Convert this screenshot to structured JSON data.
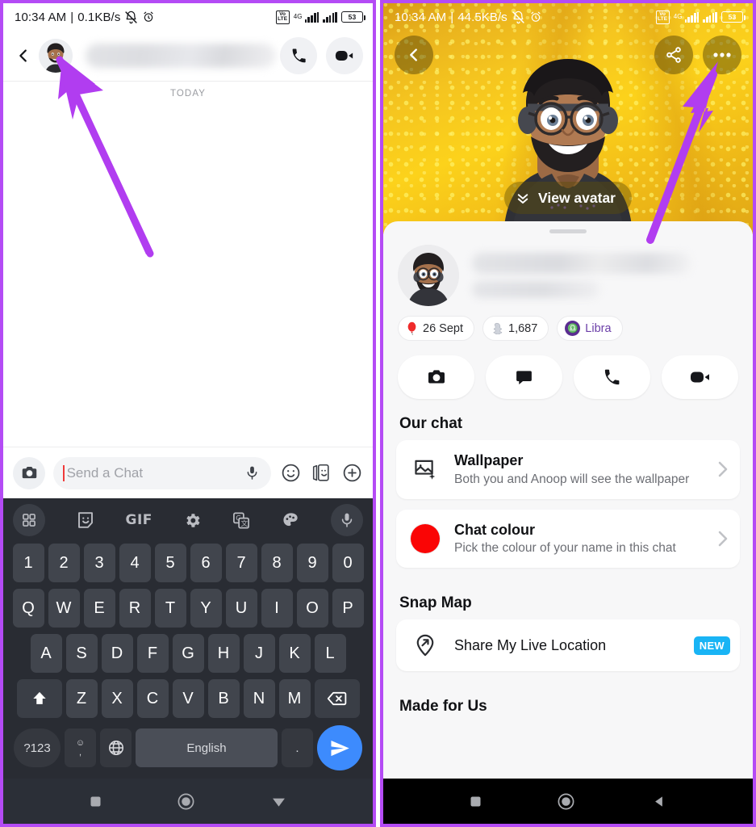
{
  "accent": {
    "frame_border": "#b44bf5",
    "arrow": "#b13df0",
    "send_blue": "#3d8bfd",
    "badge_new": "#19b4f5",
    "chat_colour_swatch": "#fa0505",
    "libra_purple": "#5b2d91"
  },
  "left_phone": {
    "status_bar": {
      "time": "10:34 AM",
      "separator": "|",
      "data_rate": "0.1KB/s",
      "mute_icon": "bell-muted-icon",
      "alarm_icon": "alarm-clock-icon",
      "volte_line1": "Vo",
      "volte_line2": "LTE",
      "network_gen": "4G",
      "battery_level": "53"
    },
    "header": {
      "back_icon": "back-chevron-icon",
      "avatar_icon": "contact-bitmoji-avatar",
      "contact_name_hidden": "",
      "call_icon": "phone-call-icon",
      "video_icon": "video-camera-icon"
    },
    "conversation": {
      "date_divider": "TODAY"
    },
    "composer": {
      "camera_icon": "camera-icon",
      "placeholder": "Send a Chat",
      "value": "",
      "mic_icon": "microphone-icon",
      "sticker_icon": "smiley-face-icon",
      "cameos_icon": "cameos-icon",
      "plus_icon": "plus-circle-icon"
    },
    "keyboard": {
      "toolbar": [
        {
          "name": "grid-menu-icon",
          "label": ""
        },
        {
          "name": "sticker-icon",
          "label": ""
        },
        {
          "name": "gif-icon",
          "label": "GIF"
        },
        {
          "name": "settings-gear-icon",
          "label": ""
        },
        {
          "name": "google-translate-icon",
          "label": ""
        },
        {
          "name": "theme-palette-icon",
          "label": ""
        },
        {
          "name": "voice-input-icon",
          "label": ""
        }
      ],
      "row_numbers": [
        "1",
        "2",
        "3",
        "4",
        "5",
        "6",
        "7",
        "8",
        "9",
        "0"
      ],
      "row_top": [
        "Q",
        "W",
        "E",
        "R",
        "T",
        "Y",
        "U",
        "I",
        "O",
        "P"
      ],
      "row_home": [
        "A",
        "S",
        "D",
        "F",
        "G",
        "H",
        "J",
        "K",
        "L"
      ],
      "row_bottom": [
        "Z",
        "X",
        "C",
        "V",
        "B",
        "N",
        "M"
      ],
      "shift_icon": "shift-arrow-icon",
      "backspace_icon": "backspace-icon",
      "symbols_key": "?123",
      "emoji_comma_key_top": "☺",
      "emoji_comma_key_bottom": ",",
      "globe_icon": "language-globe-icon",
      "space_label": "English",
      "period_key": ".",
      "send_icon": "send-paper-plane-icon"
    },
    "nav_bar": {
      "recents_icon": "square-recents-icon",
      "home_icon": "circle-home-icon",
      "back_icon": "triangle-back-icon"
    },
    "annotation": {
      "arrow_name": "purple-arrow-to-avatar"
    }
  },
  "right_phone": {
    "status_bar": {
      "time": "10:34 AM",
      "separator": "|",
      "data_rate": "44.5KB/s",
      "mute_icon": "bell-muted-icon",
      "alarm_icon": "alarm-clock-icon",
      "volte_line1": "Vo",
      "volte_line2": "LTE",
      "network_gen": "4G",
      "battery_level": "53"
    },
    "hero": {
      "back_icon": "back-chevron-icon",
      "share_icon": "share-nodes-icon",
      "more_icon": "three-dots-more-icon",
      "view_avatar_label": "View avatar",
      "view_avatar_chevron": "double-chevron-down-icon",
      "bitmoji_name": "profile-bitmoji-illustration"
    },
    "profile": {
      "avatar_icon": "profile-bitmoji-avatar",
      "display_name_hidden": "",
      "username_hidden": "",
      "chips": [
        {
          "icon": "balloon-icon",
          "label": "26 Sept",
          "name": "birthday-chip"
        },
        {
          "icon": "snapchat-ghost-icon",
          "label": "1,687",
          "name": "snapscore-chip"
        },
        {
          "icon": "libra-zodiac-icon",
          "label": "Libra",
          "name": "zodiac-chip"
        }
      ]
    },
    "quick_actions": [
      {
        "name": "send-snap-button",
        "icon": "camera-icon"
      },
      {
        "name": "send-chat-button",
        "icon": "chat-bubble-icon"
      },
      {
        "name": "voice-call-button",
        "icon": "phone-call-icon"
      },
      {
        "name": "video-call-button",
        "icon": "video-camera-icon"
      }
    ],
    "sections": [
      {
        "name": "our-chat-section",
        "title": "Our chat",
        "rows": [
          {
            "name": "wallpaper-row",
            "icon": "image-sparkle-icon",
            "title": "Wallpaper",
            "subtitle": "Both you and Anoop will see the wallpaper",
            "chevron": "chevron-right-icon",
            "badge": ""
          },
          {
            "name": "chat-colour-row",
            "icon": "colour-swatch-icon",
            "title": "Chat colour",
            "subtitle": "Pick the colour of your name in this chat",
            "chevron": "chevron-right-icon",
            "badge": ""
          }
        ]
      },
      {
        "name": "snap-map-section",
        "title": "Snap Map",
        "rows": [
          {
            "name": "share-live-location-row",
            "icon": "location-pin-arrow-icon",
            "title": "Share My Live Location",
            "subtitle": "",
            "chevron": "",
            "badge": "NEW"
          }
        ]
      },
      {
        "name": "made-for-us-section",
        "title": "Made for Us",
        "rows": []
      }
    ],
    "nav_bar": {
      "recents_icon": "square-recents-icon",
      "home_icon": "circle-home-icon",
      "back_icon": "triangle-back-icon"
    },
    "annotation": {
      "arrow_name": "purple-arrow-to-more-button"
    }
  }
}
